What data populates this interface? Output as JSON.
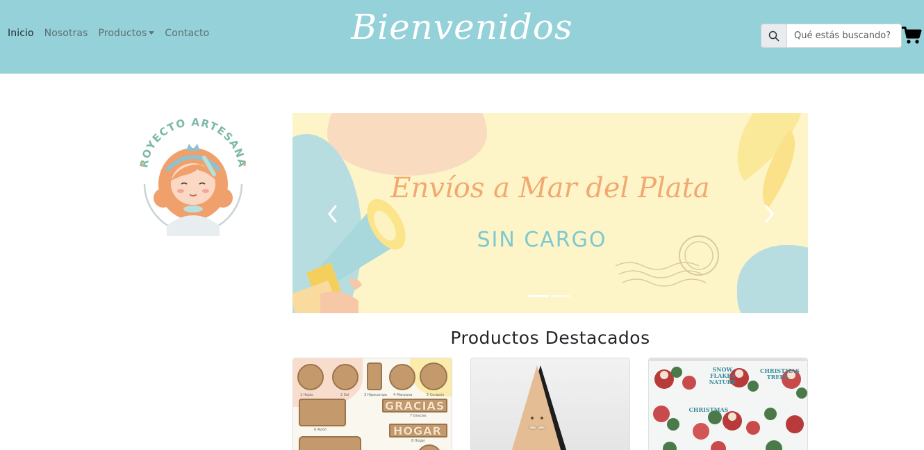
{
  "nav": {
    "links": [
      {
        "label": "Inicio"
      },
      {
        "label": "Nosotras"
      },
      {
        "label": "Productos"
      },
      {
        "label": "Contacto"
      }
    ],
    "brand": "Bienvenidos"
  },
  "search": {
    "placeholder": "Qué estás buscando?",
    "icon": "search-icon"
  },
  "cart": {
    "icon": "shopping-cart-icon"
  },
  "logo": {
    "text": "PROYECTO ARTESANAS"
  },
  "carousel": {
    "title": "Envíos a Mar del Plata",
    "subtitle": "SIN CARGO",
    "slides_count": 2,
    "active_slide": 1
  },
  "featured": {
    "title": "Productos Destacados",
    "card1": {
      "labels": [
        "1 Hojas",
        "2 Sol",
        "3 Hipocampo",
        "4 Manzana",
        "5 Corazón",
        "6 Avión",
        "7 Gracias",
        "8 Hogar"
      ],
      "words": [
        "GRACIAS",
        "HOGAR"
      ]
    },
    "card3": {
      "banners": [
        "SNOW FLAKES NATURE",
        "CHRISTMAS",
        "CHRISTMAS TREES"
      ]
    }
  },
  "colors": {
    "navbar": "#94d1d8",
    "banner_bg": "#fdf5c8",
    "banner_title": "#f2a971",
    "banner_sub": "#7ec8cf"
  }
}
